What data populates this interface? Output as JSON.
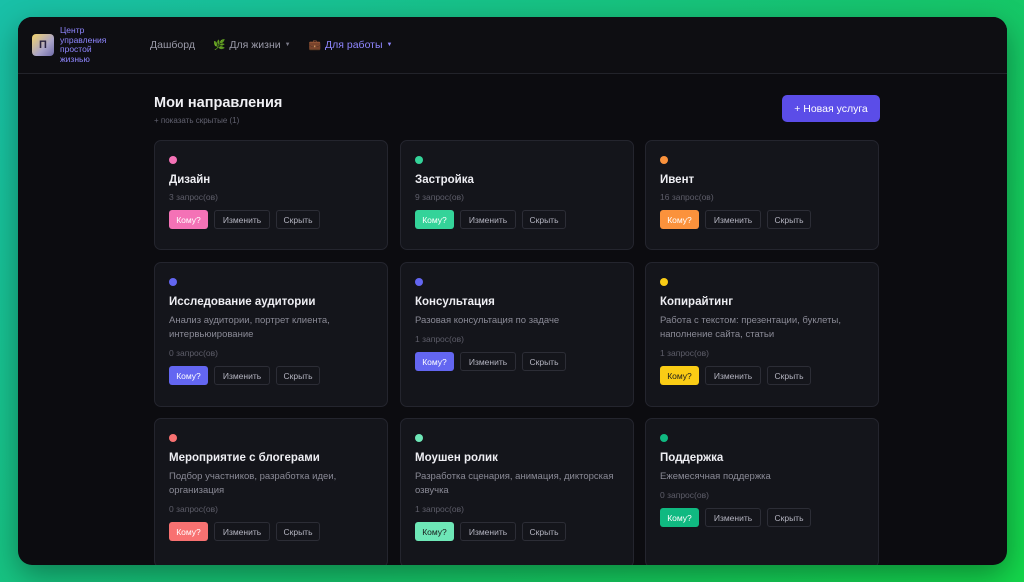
{
  "header": {
    "brand": "Центр управления простой жизнью",
    "logo_glyph": "П",
    "nav": [
      {
        "label": "Дашборд",
        "emoji": "",
        "dropdown": false,
        "active": false
      },
      {
        "label": "Для жизни",
        "emoji": "🌿",
        "dropdown": true,
        "active": false
      },
      {
        "label": "Для работы",
        "emoji": "💼",
        "dropdown": true,
        "active": true
      }
    ]
  },
  "page": {
    "title": "Мои направления",
    "show_hidden": "+ показать скрытые (1)",
    "new_button": "+ Новая услуга"
  },
  "cards": [
    {
      "title": "Дизайн",
      "description": "",
      "count": "3 запрос(ов)",
      "color": "#f472b6",
      "who": "Кому?",
      "edit": "Изменить",
      "hide": "Скрыть"
    },
    {
      "title": "Застройка",
      "description": "",
      "count": "9 запрос(ов)",
      "color": "#34d399",
      "who": "Кому?",
      "edit": "Изменить",
      "hide": "Скрыть"
    },
    {
      "title": "Ивент",
      "description": "",
      "count": "16 запрос(ов)",
      "color": "#fb923c",
      "who": "Кому?",
      "edit": "Изменить",
      "hide": "Скрыть"
    },
    {
      "title": "Исследование аудитории",
      "description": "Анализ аудитории, портрет клиента, интервьюирование",
      "count": "0 запрос(ов)",
      "color": "#6366f1",
      "who": "Кому?",
      "edit": "Изменить",
      "hide": "Скрыть"
    },
    {
      "title": "Консультация",
      "description": "Разовая консультация по задаче",
      "count": "1 запрос(ов)",
      "color": "#6366f1",
      "who": "Кому?",
      "edit": "Изменить",
      "hide": "Скрыть"
    },
    {
      "title": "Копирайтинг",
      "description": "Работа с текстом: презентации, буклеты, наполнение сайта, статьи",
      "count": "1 запрос(ов)",
      "color": "#facc15",
      "who": "Кому?",
      "edit": "Изменить",
      "hide": "Скрыть"
    },
    {
      "title": "Мероприятие с блогерами",
      "description": "Подбор участников, разработка идеи, организация",
      "count": "0 запрос(ов)",
      "color": "#f87171",
      "who": "Кому?",
      "edit": "Изменить",
      "hide": "Скрыть"
    },
    {
      "title": "Моушен ролик",
      "description": "Разработка сценария, анимация, дикторская озвучка",
      "count": "1 запрос(ов)",
      "color": "#6ee7b7",
      "who": "Кому?",
      "edit": "Изменить",
      "hide": "Скрыть"
    },
    {
      "title": "Поддержка",
      "description": "Ежемесячная поддержка",
      "count": "0 запрос(ов)",
      "color": "#10b981",
      "who": "Кому?",
      "edit": "Изменить",
      "hide": "Скрыть"
    }
  ]
}
